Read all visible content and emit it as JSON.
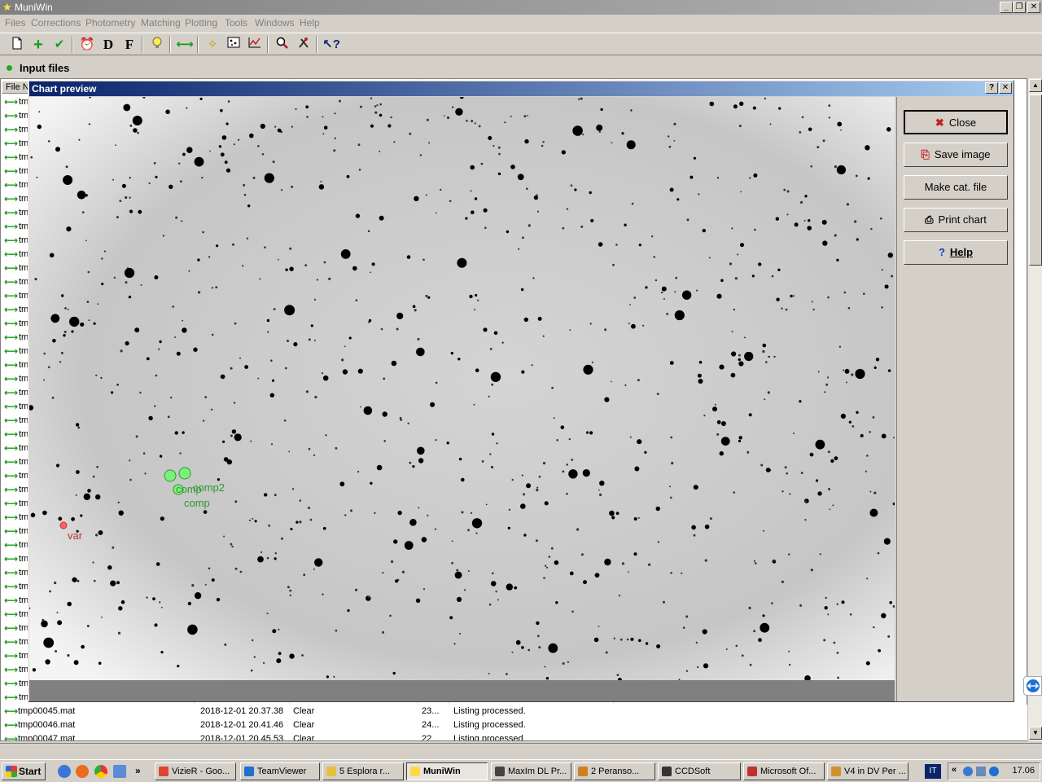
{
  "window": {
    "title": "MuniWin"
  },
  "menu": [
    "Files",
    "Corrections",
    "Photometry",
    "Matching",
    "Plotting",
    "Tools",
    "Windows",
    "Help"
  ],
  "toolbar_icons": [
    "new-icon",
    "add-icon",
    "check-icon",
    "alarm-icon",
    "dark-icon",
    "flat-icon",
    "bulb-icon",
    "arrows-icon",
    "star-icon",
    "match-icon",
    "plot-icon",
    "zoom-icon",
    "tools-icon",
    "help-pointer-icon"
  ],
  "toolbar_letters": {
    "dark": "D",
    "flat": "F"
  },
  "input_files": {
    "title": "Input files",
    "header_col": "File N"
  },
  "file_rows_visible": {
    "stub": "tm"
  },
  "dialog": {
    "title": "Chart preview",
    "buttons": {
      "close": "Close",
      "save": "Save image",
      "make_cat": "Make cat. file",
      "print": "Print chart",
      "help": "Help"
    },
    "labels": {
      "var": "var",
      "comp": "comp",
      "comp2": "comp2",
      "comp_overlap": "comp"
    },
    "colors": {
      "var": "#c03030",
      "comp": "#2e9a2e",
      "comp_fill": "#7cf07c"
    }
  },
  "bottom_rows": [
    {
      "file": "tmp00045.mat",
      "date": "2018-12-01 20.37.38",
      "filter": "Clear",
      "num": "23...",
      "status": "Listing processed."
    },
    {
      "file": "tmp00046.mat",
      "date": "2018-12-01 20.41.46",
      "filter": "Clear",
      "num": "24...",
      "status": "Listing processed."
    },
    {
      "file": "tmp00047.mat",
      "date": "2018-12-01 20.45.53",
      "filter": "Clear",
      "num": "22...",
      "status": "Listing processed."
    }
  ],
  "taskbar": {
    "start": "Start",
    "tasks": [
      {
        "label": "VizieR - Goo...",
        "color": "#dd4433"
      },
      {
        "label": "TeamViewer",
        "color": "#1e6fd0"
      },
      {
        "label": "5 Esplora r...",
        "color": "#e8c040"
      },
      {
        "label": "MuniWin",
        "color": "#ffd84a",
        "active": true
      },
      {
        "label": "MaxIm DL Pr...",
        "color": "#444"
      },
      {
        "label": "2 Peranso...",
        "color": "#d08020"
      },
      {
        "label": "CCDSoft",
        "color": "#333"
      },
      {
        "label": "Microsoft Of...",
        "color": "#c03030"
      },
      {
        "label": "V4 in DV Per ...",
        "color": "#d09030"
      }
    ],
    "lang": "IT",
    "clock": "17.06"
  }
}
